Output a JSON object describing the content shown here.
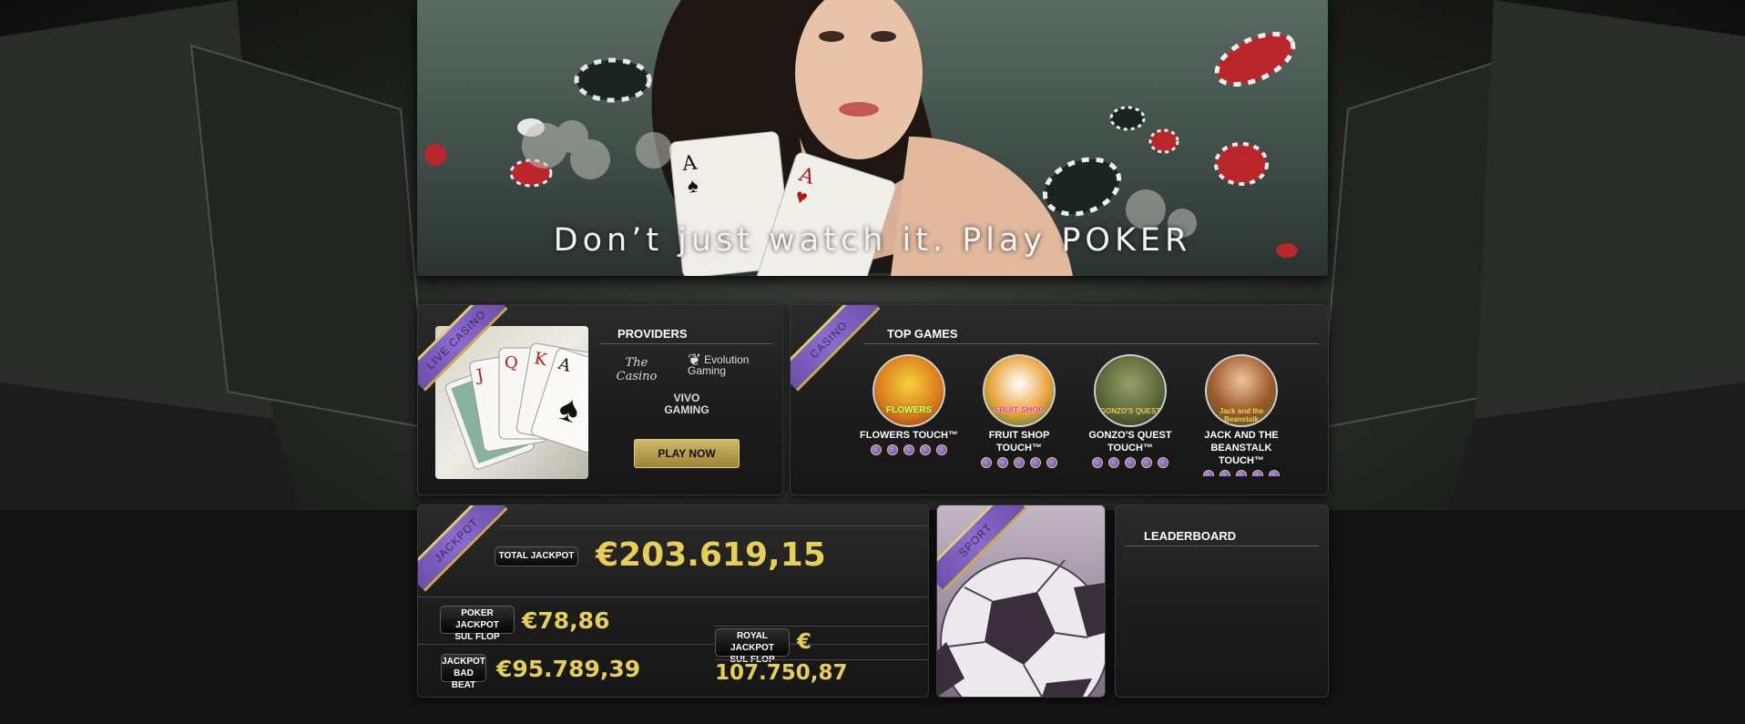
{
  "hero": {
    "tagline": "Don’t just watch it. Play POKER"
  },
  "live_casino": {
    "ribbon": "LIVE CASINO",
    "providers_title": "PROVIDERS",
    "providers": [
      "The Casino",
      "Evolution Gaming",
      "VIVO GAMING"
    ],
    "play_button": "PLAY NOW"
  },
  "casino": {
    "ribbon": "CASINO",
    "title": "TOP GAMES",
    "games": [
      {
        "name": "FLOWERS TOUCH™",
        "logo": "FLOWERS",
        "rating": 5
      },
      {
        "name": "FRUIT SHOP TOUCH™",
        "logo": "FRUIT SHOP",
        "rating": 5
      },
      {
        "name": "GONZO'S QUEST TOUCH™",
        "logo": "GONZO'S QUEST",
        "rating": 5
      },
      {
        "name": "JACK AND THE BEANSTALK TOUCH™",
        "logo": "Jack and the Beanstalk",
        "rating": 5
      }
    ]
  },
  "jackpot": {
    "ribbon": "JACKPOT",
    "total_label": "TOTAL JACKPOT",
    "total_value": "€203.619,15",
    "poker_label_1": "POKER JACKPOT",
    "poker_label_2": "SUL FLOP",
    "poker_value": "€78,86",
    "badbeat_label_1": "JACKPOT",
    "badbeat_label_2": "BAD BEAT",
    "badbeat_value": "€95.789,39",
    "royal_label_1": "ROYAL JACKPOT",
    "royal_label_2": "SUL FLOP",
    "royal_value_1": "€",
    "royal_value_2": "107.750,87"
  },
  "sport": {
    "ribbon": "SPORT"
  },
  "leaderboard": {
    "title": "LEADERBOARD"
  },
  "colors": {
    "accent_gold": "#e6cf56",
    "ribbon_purple": "#7a5cbf",
    "ribbon_border": "#e2c97c"
  }
}
